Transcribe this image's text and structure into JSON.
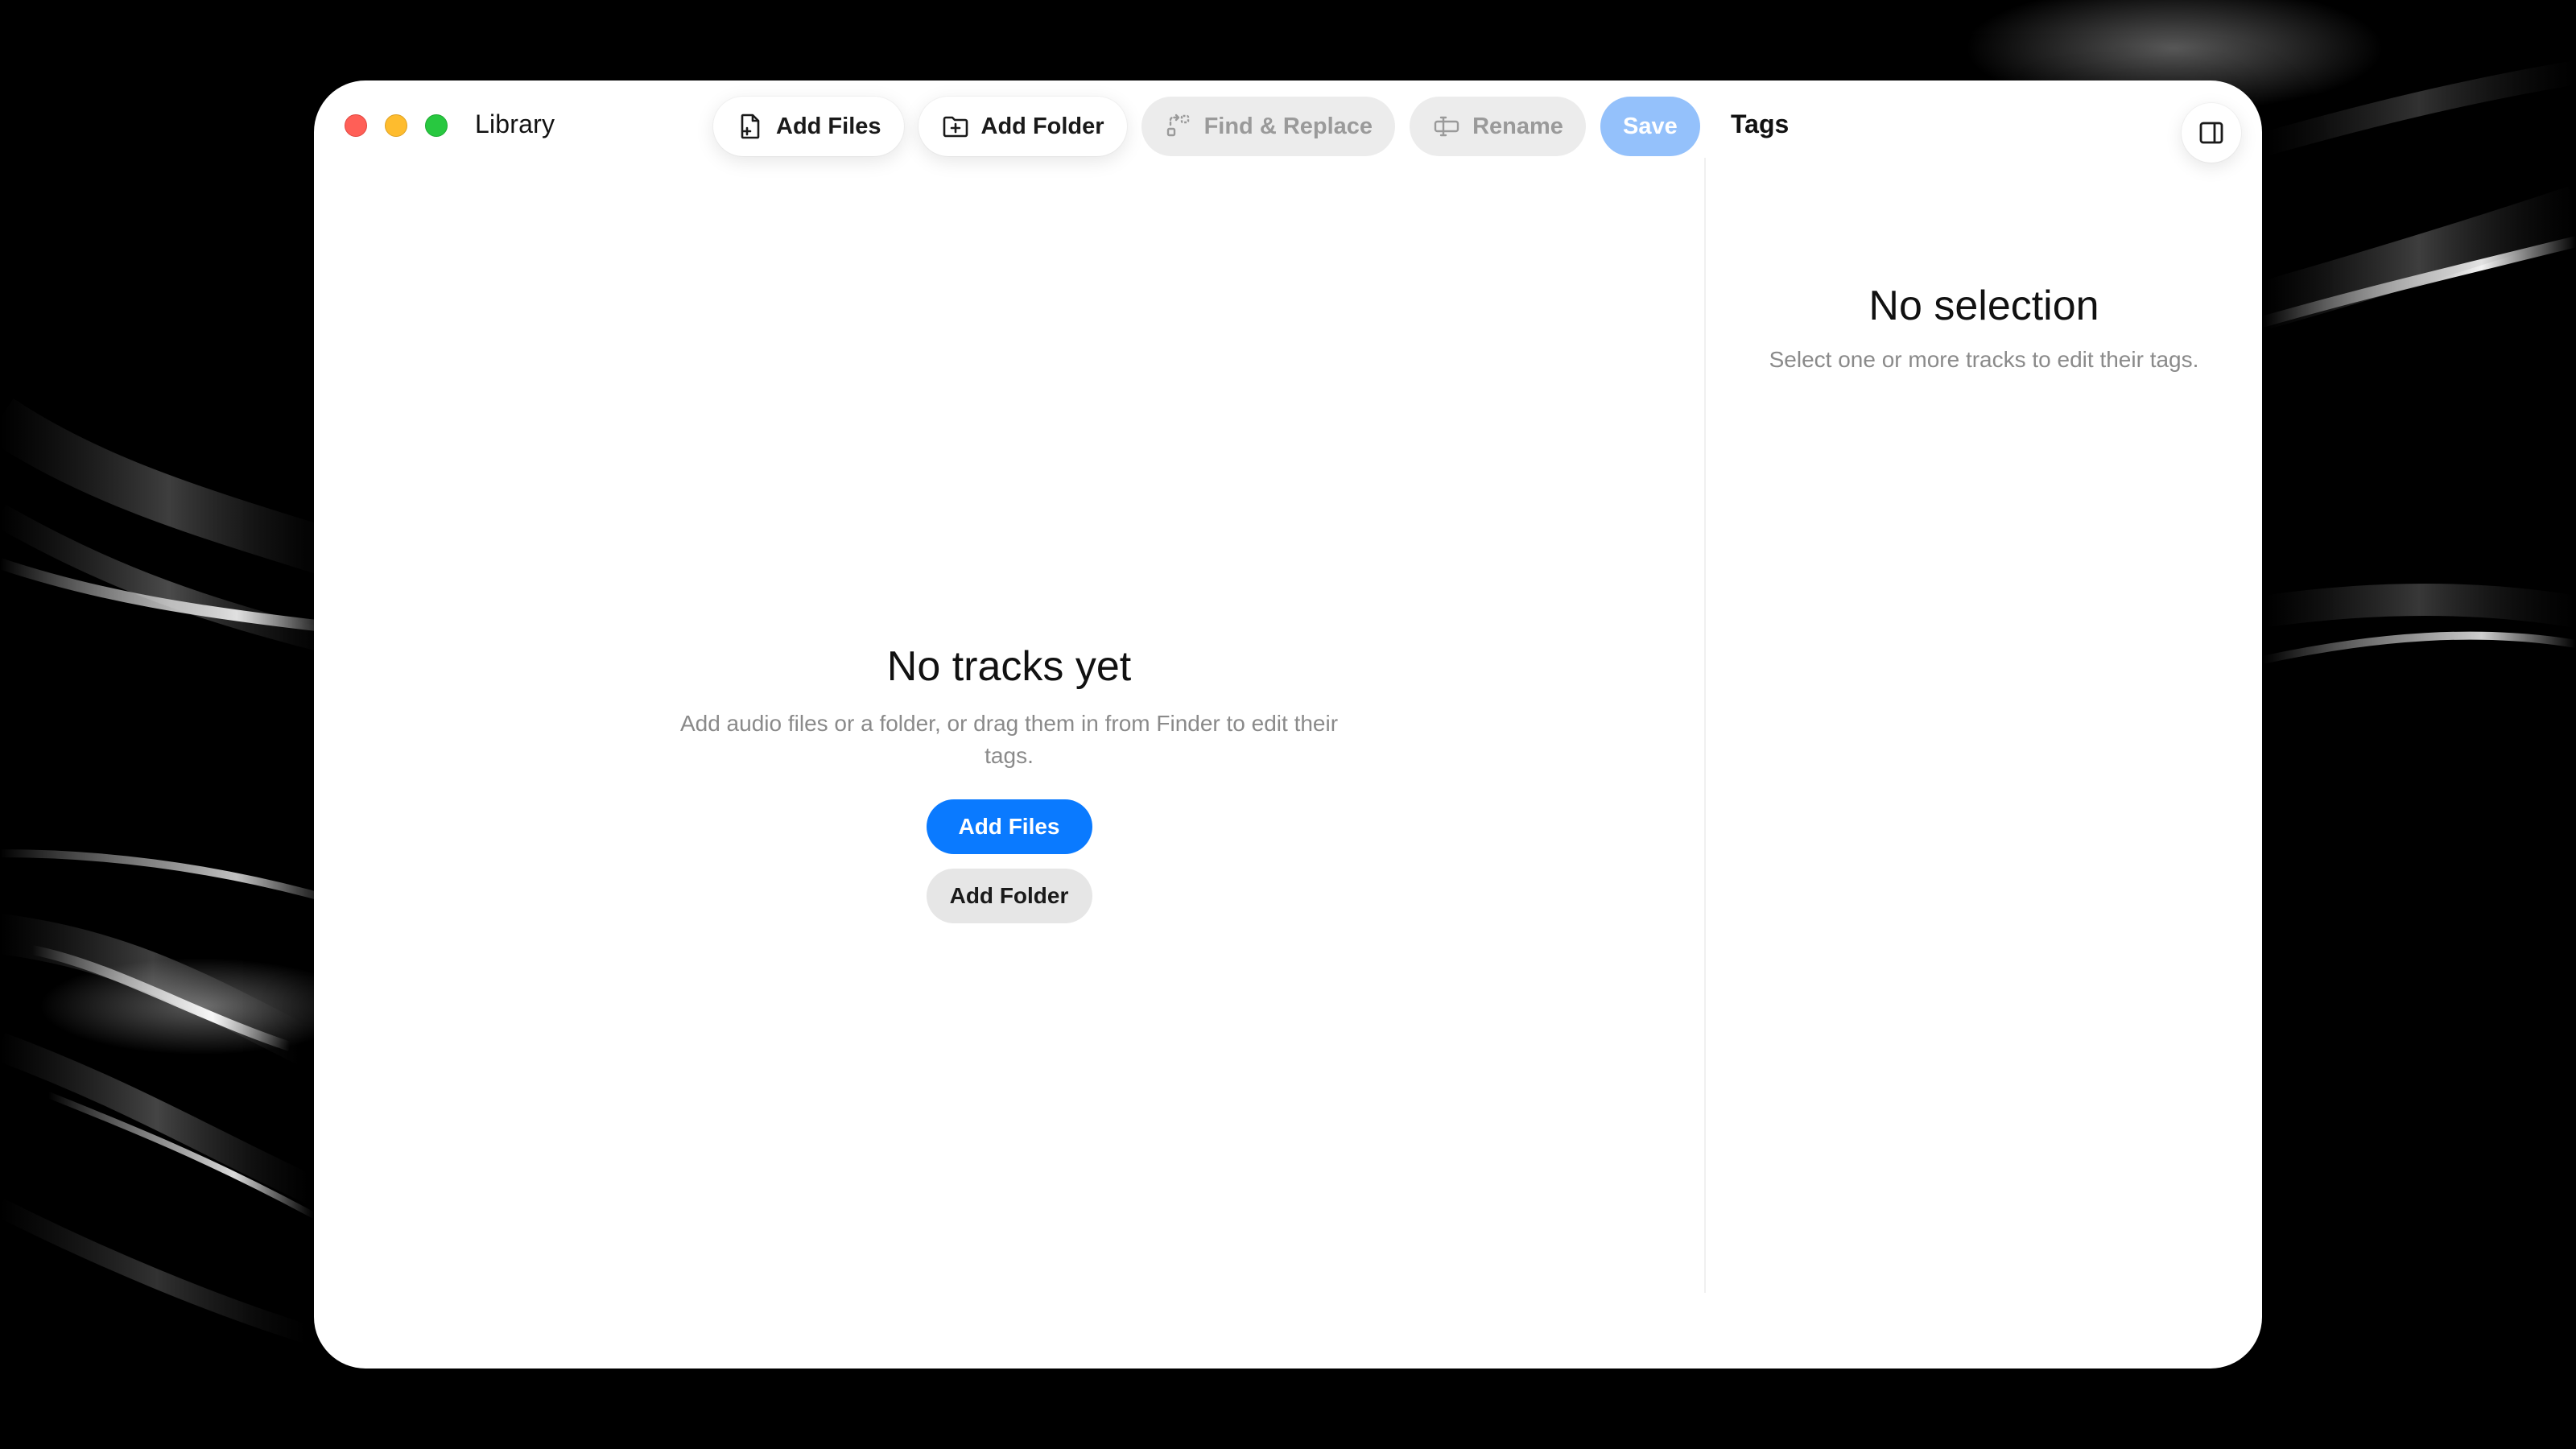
{
  "window": {
    "title": "Library"
  },
  "toolbar": {
    "add_files_label": "Add Files",
    "add_folder_label": "Add Folder",
    "find_replace_label": "Find & Replace",
    "rename_label": "Rename",
    "save_label": "Save"
  },
  "main": {
    "empty_title": "No tracks yet",
    "empty_subtitle": "Add audio files or a folder, or drag them in from Finder to edit their tags.",
    "primary_button_label": "Add Files",
    "secondary_button_label": "Add Folder"
  },
  "inspector": {
    "title": "Tags",
    "empty_title": "No selection",
    "empty_subtitle": "Select one or more tracks to edit their tags."
  },
  "colors": {
    "accent": "#0a7aff",
    "save_disabled": "#94c1fb",
    "close": "#ff5f57",
    "minimize": "#febc2e",
    "maximize": "#28c840"
  },
  "icons": {
    "add_files": "doc-plus-icon",
    "add_folder": "folder-plus-icon",
    "find_replace": "find-replace-icon",
    "rename": "rename-icon",
    "sidebar_toggle": "sidebar-right-icon"
  }
}
